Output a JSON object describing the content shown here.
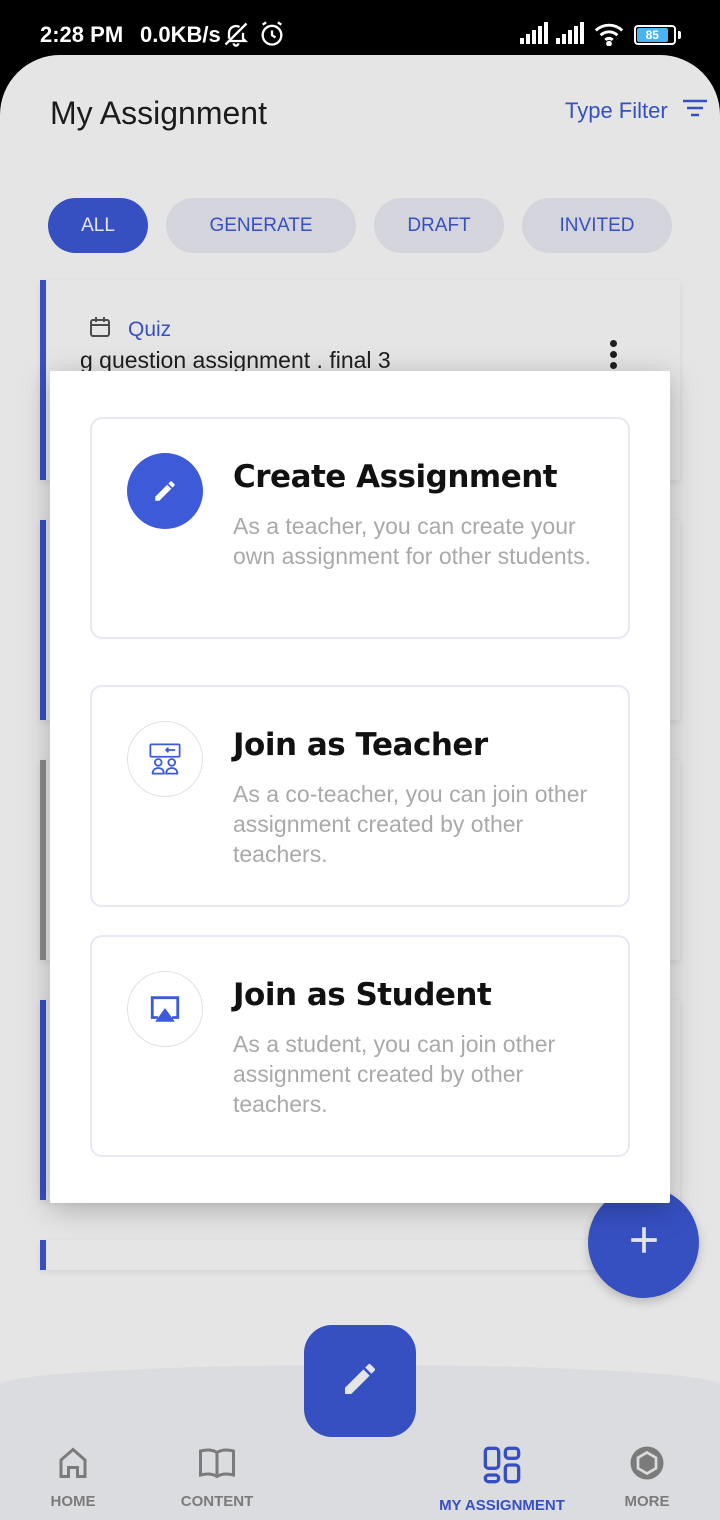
{
  "status_bar": {
    "time": "2:28 PM",
    "network_speed": "0.0KB/s",
    "battery": "85",
    "icons": [
      "bell-off-icon",
      "alarm-icon",
      "signal-icon",
      "signal-icon",
      "wifi-icon",
      "battery-icon"
    ]
  },
  "header": {
    "title": "My Assignment",
    "filter_label": "Type Filter",
    "filter_icon": "filter-icon"
  },
  "chips": [
    {
      "label": "ALL",
      "active": true
    },
    {
      "label": "GENERATE",
      "active": false
    },
    {
      "label": "DRAFT",
      "active": false
    },
    {
      "label": "INVITED",
      "active": false
    }
  ],
  "assignment_card": {
    "type_label": "Quiz",
    "title": "g question assignment . final 3"
  },
  "dialog": {
    "options": [
      {
        "title": "Create Assignment",
        "description": "As a teacher, you can create your own assignment for other students.",
        "icon": "pencil-icon"
      },
      {
        "title": "Join as Teacher",
        "description": "As a co-teacher, you can join other assignment created by other teachers.",
        "icon": "teacher-classroom-icon"
      },
      {
        "title": "Join as Student",
        "description": "As a student, you can join other assignment created by other teachers.",
        "icon": "airplay-screen-icon"
      }
    ]
  },
  "fab": {
    "icon": "plus-icon"
  },
  "bottom_nav": {
    "items": [
      {
        "label": "HOME",
        "icon": "home-icon",
        "active": false
      },
      {
        "label": "CONTENT",
        "icon": "book-icon",
        "active": false
      },
      {
        "label": "MY ASSIGNMENT",
        "icon": "dashboard-icon",
        "active": true
      },
      {
        "label": "MORE",
        "icon": "hexagon-icon",
        "active": false
      }
    ],
    "center_icon": "pencil-icon"
  },
  "colors": {
    "accent": "#3d5ad9",
    "chip_bg": "#eceef5",
    "muted_text": "#a9a9a9"
  }
}
